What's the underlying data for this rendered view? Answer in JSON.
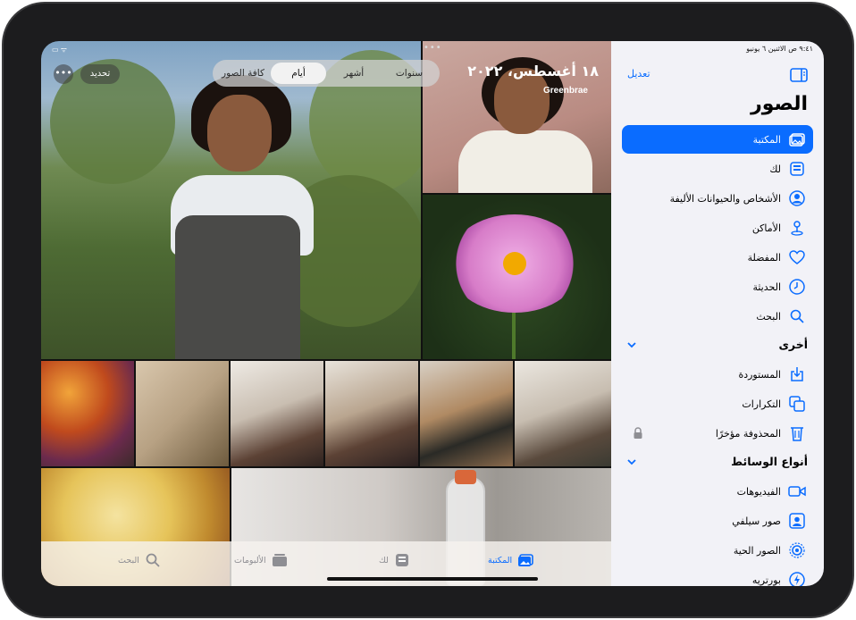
{
  "status": {
    "left_icons": "▭ ᯤ",
    "time_date": "٩:٤١ ص   الاثنين ٦ يونيو"
  },
  "photos": {
    "more_dots": "•••",
    "more_button": "•••",
    "select_button": "تحديد",
    "segments": [
      "سنوات",
      "أشهر",
      "أيام",
      "كافة الصور"
    ],
    "active_segment": "أيام",
    "date_title": "١٨ أغسطس، ٢٠٢٢",
    "location": "Greenbrae"
  },
  "tabbar": {
    "library": "المكتبة",
    "for_you": "لك",
    "albums": "الألبومات",
    "search": "البحث"
  },
  "sidebar": {
    "edit": "تعديل",
    "title": "الصور",
    "items": [
      {
        "label": "المكتبة",
        "icon": "library-icon",
        "active": true
      },
      {
        "label": "لك",
        "icon": "for-you-icon"
      },
      {
        "label": "الأشخاص والحيوانات الأليفة",
        "icon": "people-icon"
      },
      {
        "label": "الأماكن",
        "icon": "places-icon"
      },
      {
        "label": "المفضلة",
        "icon": "heart-icon"
      },
      {
        "label": "الحديثة",
        "icon": "clock-icon"
      },
      {
        "label": "البحث",
        "icon": "search-icon"
      }
    ],
    "section_other": "أخرى",
    "other_items": [
      {
        "label": "المستوردة",
        "icon": "import-icon"
      },
      {
        "label": "التكرارات",
        "icon": "duplicates-icon"
      },
      {
        "label": "المحذوفة مؤخرًا",
        "icon": "trash-icon"
      }
    ],
    "section_media": "أنواع الوسائط",
    "media_items": [
      {
        "label": "الفيديوهات",
        "icon": "video-icon"
      },
      {
        "label": "صور سيلفي",
        "icon": "selfie-icon"
      },
      {
        "label": "الصور الحية",
        "icon": "live-photo-icon"
      },
      {
        "label": "بورتريه",
        "icon": "portrait-icon"
      }
    ]
  },
  "colors": {
    "accent": "#0a6cff",
    "sidebar_bg": "#f2f2f7",
    "device_frame": "#1c1c1e"
  }
}
